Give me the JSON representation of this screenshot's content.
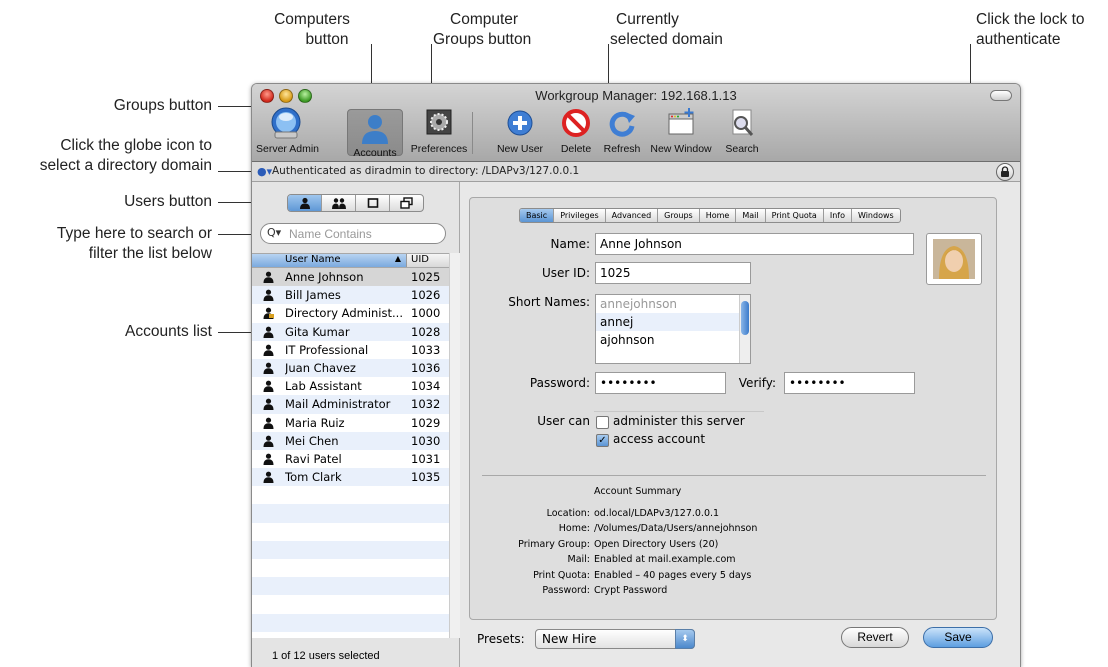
{
  "callouts": {
    "computers_button": [
      "Computers",
      "button"
    ],
    "computer_groups_button": [
      "Computer",
      "Groups button"
    ],
    "currently_selected_domain": [
      "Currently",
      "selected domain"
    ],
    "click_lock": [
      "Click the lock to",
      "authenticate"
    ],
    "groups_button": "Groups button",
    "globe_icon": [
      "Click the globe icon to",
      "select a directory domain"
    ],
    "users_button": "Users button",
    "search_filter": [
      "Type here to search or",
      "filter the list below"
    ],
    "accounts_list": "Accounts list"
  },
  "window": {
    "title": "Workgroup Manager: 192.168.1.13"
  },
  "toolbar": {
    "items": [
      {
        "label": "Server Admin",
        "icon": "server-admin-icon"
      },
      {
        "label": "Accounts",
        "icon": "accounts-icon"
      },
      {
        "label": "Preferences",
        "icon": "preferences-icon"
      },
      {
        "label": "New User",
        "icon": "new-user-icon"
      },
      {
        "label": "Delete",
        "icon": "delete-icon"
      },
      {
        "label": "Refresh",
        "icon": "refresh-icon"
      },
      {
        "label": "New Window",
        "icon": "new-window-icon"
      },
      {
        "label": "Search",
        "icon": "search-icon"
      }
    ]
  },
  "authbar": {
    "text": "Authenticated as diradmin to directory: /LDAPv3/127.0.0.1"
  },
  "search": {
    "placeholder": "Name Contains"
  },
  "list": {
    "col_name": "User Name",
    "col_uid": "UID",
    "rows": [
      {
        "name": "Anne Johnson",
        "uid": "1025"
      },
      {
        "name": "Bill James",
        "uid": "1026"
      },
      {
        "name": "Directory Administ...",
        "uid": "1000"
      },
      {
        "name": "Gita Kumar",
        "uid": "1028"
      },
      {
        "name": "IT Professional",
        "uid": "1033"
      },
      {
        "name": "Juan Chavez",
        "uid": "1036"
      },
      {
        "name": "Lab Assistant",
        "uid": "1034"
      },
      {
        "name": "Mail Administrator",
        "uid": "1032"
      },
      {
        "name": "Maria Ruiz",
        "uid": "1029"
      },
      {
        "name": "Mei Chen",
        "uid": "1030"
      },
      {
        "name": "Ravi Patel",
        "uid": "1031"
      },
      {
        "name": "Tom Clark",
        "uid": "1035"
      }
    ],
    "status": "1 of 12 users selected"
  },
  "tabs": [
    "Basic",
    "Privileges",
    "Advanced",
    "Groups",
    "Home",
    "Mail",
    "Print Quota",
    "Info",
    "Windows"
  ],
  "form": {
    "name_label": "Name:",
    "name_value": "Anne Johnson",
    "userid_label": "User ID:",
    "userid_value": "1025",
    "short_names_label": "Short Names:",
    "short_names": [
      "annejohnson",
      "annej",
      "ajohnson"
    ],
    "password_label": "Password:",
    "password_value": "••••••••",
    "verify_label": "Verify:",
    "verify_value": "••••••••",
    "user_can_label": "User can",
    "administer_label": "administer this server",
    "administer_checked": false,
    "access_label": "access account",
    "access_checked": true
  },
  "summary": {
    "title": "Account Summary",
    "rows": [
      {
        "key": "Location:",
        "value": "od.local/LDAPv3/127.0.0.1"
      },
      {
        "key": "Home:",
        "value": "/Volumes/Data/Users/annejohnson"
      },
      {
        "key": "Primary Group:",
        "value": "Open Directory Users (20)"
      },
      {
        "key": "Mail:",
        "value": "Enabled at mail.example.com"
      },
      {
        "key": "Print Quota:",
        "value": "Enabled – 40 pages every 5 days"
      },
      {
        "key": "Password:",
        "value": "Crypt Password"
      }
    ]
  },
  "footer": {
    "presets_label": "Presets:",
    "presets_value": "New Hire",
    "revert_label": "Revert",
    "save_label": "Save"
  }
}
